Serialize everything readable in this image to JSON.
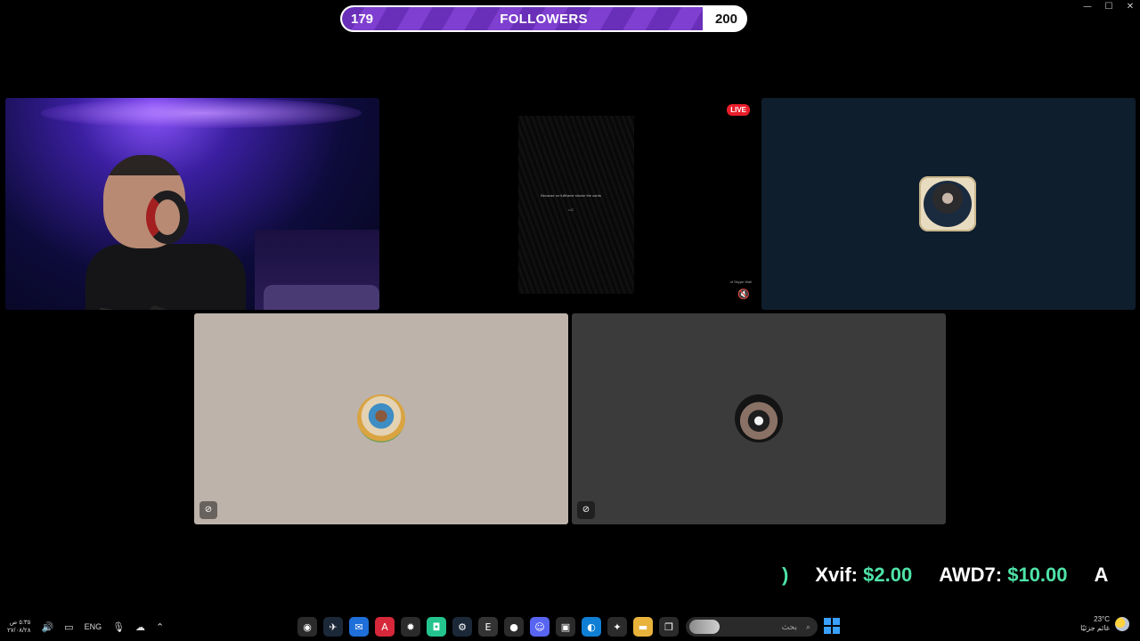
{
  "window_controls": {
    "minimize": "—",
    "maximize": "☐",
    "close": "✕"
  },
  "followers_goal": {
    "current": "179",
    "label": "FOLLOWERS",
    "target": "200",
    "progress": 0.895
  },
  "tiles": {
    "screen": {
      "message": "Because no fullframe shown the cards",
      "submessage": "c42",
      "live_badge": "LIVE",
      "caption": "of Skype Wall",
      "mute_icon": "🔇"
    },
    "participant_bottom_left": {
      "mic_icon": "⊘"
    },
    "participant_bottom_right": {
      "mic_icon": "⊘"
    }
  },
  "donations": {
    "lead_fragment": ")",
    "items": [
      {
        "name": "Xvif:",
        "amount": "$2.00"
      },
      {
        "name": "AWD7:",
        "amount": "$10.00"
      },
      {
        "name": "A",
        "amount": ""
      }
    ]
  },
  "taskbar": {
    "clock_time": "٥:٣٥ ص",
    "clock_date": "٢٧/٠٨/٢٨",
    "language": "ENG",
    "search_placeholder": "بحث",
    "weather_temp": "23°C",
    "weather_desc": "غائم جزئيًا",
    "apps": [
      {
        "name": "obs",
        "glyph": "◉",
        "color": "#2b2b2b"
      },
      {
        "name": "steam-tool",
        "glyph": "✈",
        "color": "#1b2838"
      },
      {
        "name": "mail",
        "glyph": "✉",
        "color": "#1e6fd9"
      },
      {
        "name": "app-a",
        "glyph": "A",
        "color": "#d6283a"
      },
      {
        "name": "steelseries",
        "glyph": "✹",
        "color": "#2b2b2b"
      },
      {
        "name": "discord-like",
        "glyph": "◘",
        "color": "#23c48e"
      },
      {
        "name": "steam",
        "glyph": "⚙",
        "color": "#1b2838"
      },
      {
        "name": "epic",
        "glyph": "E",
        "color": "#333"
      },
      {
        "name": "chrome",
        "glyph": "●",
        "color": "#2b2b2b"
      },
      {
        "name": "discord",
        "glyph": "☺",
        "color": "#5865f2"
      },
      {
        "name": "store",
        "glyph": "▣",
        "color": "#2b2b2b"
      },
      {
        "name": "edge",
        "glyph": "◐",
        "color": "#0f7fd6"
      },
      {
        "name": "copilot",
        "glyph": "✦",
        "color": "#2b2b2b"
      },
      {
        "name": "explorer",
        "glyph": "▬",
        "color": "#e8b23b"
      },
      {
        "name": "taskview",
        "glyph": "❐",
        "color": "#2b2b2b"
      }
    ]
  }
}
